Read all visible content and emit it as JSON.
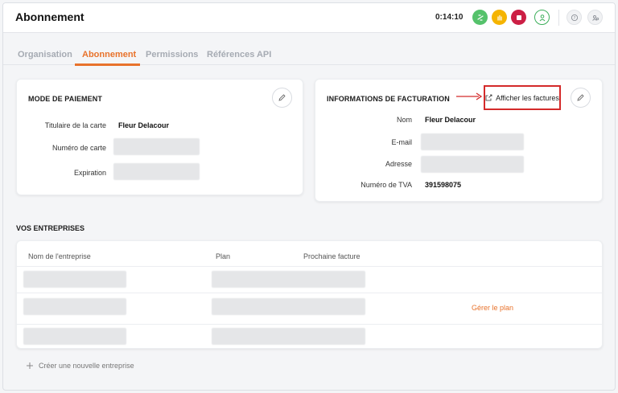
{
  "header": {
    "title": "Abonnement",
    "timer": "0:14:10",
    "colors": {
      "green": "#55c26b",
      "yellow": "#f5b400",
      "red": "#cc1f45",
      "outline_green": "#3cae5a",
      "gray": "#b0b4ba"
    }
  },
  "tabs": [
    {
      "label": "Organisation",
      "active": false
    },
    {
      "label": "Abonnement",
      "active": true
    },
    {
      "label": "Permissions",
      "active": false
    },
    {
      "label": "Références API",
      "active": false
    }
  ],
  "payment": {
    "title": "MODE DE PAIEMENT",
    "cardholder_label": "Titulaire de la carte",
    "cardholder_value": "Fleur Delacour",
    "card_number_label": "Numéro de carte",
    "expiry_label": "Expiration"
  },
  "billing": {
    "title": "INFORMATIONS DE FACTURATION",
    "view_invoices": "Afficher les factures",
    "name_label": "Nom",
    "name_value": "Fleur Delacour",
    "email_label": "E-mail",
    "address_label": "Adresse",
    "vat_label": "Numéro de TVA",
    "vat_value": "391598075"
  },
  "companies": {
    "title": "VOS ENTREPRISES",
    "columns": [
      "Nom de l'entreprise",
      "Plan",
      "Prochaine facture"
    ],
    "manage_label": "Gérer le plan",
    "create_label": "Créer une nouvelle entreprise"
  },
  "accent": "#e8722b",
  "annotation_color": "#d42a2a"
}
